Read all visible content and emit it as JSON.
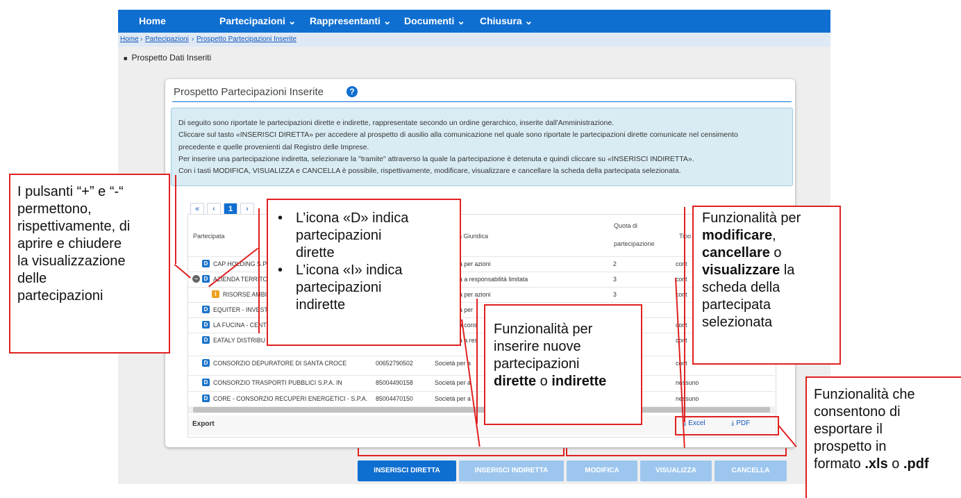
{
  "nav": {
    "items": [
      "Home",
      "Partecipazioni",
      "Rappresentanti",
      "Documenti",
      "Chiusura"
    ]
  },
  "breadcrumb": [
    "Home",
    "Partecipazioni",
    "Prospetto Partecipazioni Inserite"
  ],
  "section_title": "Prospetto Dati Inseriti",
  "card": {
    "title": "Prospetto Partecipazioni Inserite",
    "help_icon": "?",
    "info_lines": [
      "Di seguito sono riportate le partecipazioni dirette e indirette, rappresentate secondo un ordine gerarchico, inserite dall'Amministrazione.",
      "Cliccare sul tasto «INSERISCI DIRETTA» per accedere al prospetto di ausilio alla comunicazione nel quale sono riportate le partecipazioni dirette comunicate nel censimento",
      "precedente e quelle provenienti dal Registro delle Imprese.",
      "Per inserire una partecipazione indiretta, selezionare la \"tramite\" attraverso la quale la partecipazione è detenuta e quindi cliccare su «INSERISCI INDIRETTA».",
      "Con i tasti MODIFICA, VISUALIZZA e CANCELLA è possibile, rispettivamente, modificare, visualizzare e cancellare la scheda della partecipata selezionata."
    ]
  },
  "pager": {
    "first": "«",
    "prev": "‹",
    "current": "1",
    "next": "›"
  },
  "table": {
    "headers": {
      "partecipata": "Partecipata",
      "forma": "a Giuridica",
      "quota_1": "Quota di",
      "quota_2": "partecipazione",
      "tipo": "Tipo"
    },
    "rows": [
      {
        "badge": "D",
        "name": "CAP HOLDING S.P",
        "cf": "",
        "forma": "à per azioni",
        "quota": "2",
        "tipo": "cont"
      },
      {
        "badge": "D",
        "name": "AZIENDA TERRITO",
        "cf": "",
        "forma": "à a responsabilità limitata",
        "quota": "3",
        "tipo": "cont"
      },
      {
        "badge": "I",
        "name": "RISORSE AMBI",
        "cf": "",
        "forma": "à per azioni",
        "quota": "3",
        "tipo": "cont"
      },
      {
        "badge": "D",
        "name": "EQUITER - INVEST",
        "cf": "",
        "forma": "à per",
        "quota": "",
        "tipo": ""
      },
      {
        "badge": "D",
        "name": "LA FUCINA - CENT",
        "cf": "",
        "forma": "à cons",
        "quota": "",
        "tipo": "cont"
      },
      {
        "badge": "D",
        "name": "EATALY DISTRIBU",
        "cf": "",
        "forma": "à a res",
        "quota": "",
        "tipo": "cont"
      },
      {
        "badge": "D",
        "name": "CONSORZIO DEPURATORE DI SANTA CROCE",
        "cf": "00652790502",
        "forma": "Società per a",
        "quota": "",
        "tipo": "cont"
      },
      {
        "badge": "D",
        "name": "CONSORZIO TRASPORTI PUBBLICI S.P.A. IN",
        "cf": "85004490158",
        "forma": "Società per a",
        "quota": "",
        "tipo": "nessuno"
      },
      {
        "badge": "D",
        "name": "CORE - CONSORZIO RECUPERI ENERGETICI - S.P.A.",
        "cf": "85004470150",
        "forma": "Società per a",
        "quota": "",
        "tipo": "nessuno"
      }
    ],
    "export_label": "Export",
    "excel_label": "Excel",
    "pdf_label": "PDF"
  },
  "buttons": {
    "inserisci_diretta": "INSERISCI DIRETTA",
    "inserisci_indiretta": "INSERISCI INDIRETTA",
    "modifica": "MODIFICA",
    "visualizza": "VISUALIZZA",
    "cancella": "CANCELLA"
  },
  "callouts": {
    "plus_minus": [
      "I pulsanti “+” e “-“",
      "permettono,",
      "rispettivamente, di",
      "aprire e chiudere",
      "la visualizzazione",
      "delle",
      "partecipazioni"
    ],
    "icons_d": [
      "L’icona «D» indica",
      "partecipazioni",
      "dirette"
    ],
    "icons_i": [
      "L’icona «I» indica",
      "partecipazioni",
      "indirette"
    ],
    "insert": {
      "l1": "Funzionalità  per",
      "l2": "inserire nuove",
      "l3": "partecipazioni",
      "b1": "dirette",
      "m1": " o ",
      "b2": "indirette"
    },
    "edit": {
      "l1": "Funzionalità  per",
      "b1": "modificare",
      "m1": ",",
      "b2": "cancellare",
      "m2": " o",
      "b3": "visualizzare",
      "m3": " la",
      "l5": "scheda della",
      "l6": "partecipata",
      "l7": "selezionata"
    },
    "export": {
      "l1": "Funzionalità  che",
      "l2": "consentono di",
      "l3": "esportare il",
      "l4": "prospetto in",
      "m1": "formato ",
      "b1": ".xls",
      "m2": " o ",
      "b2": ".pdf"
    }
  },
  "colors": {
    "primary": "#0f6fd1",
    "disabled": "#9dc6ee",
    "callout_border": "#e02020",
    "badge_direct": "#1a73c9",
    "badge_indirect": "#f0a020"
  }
}
